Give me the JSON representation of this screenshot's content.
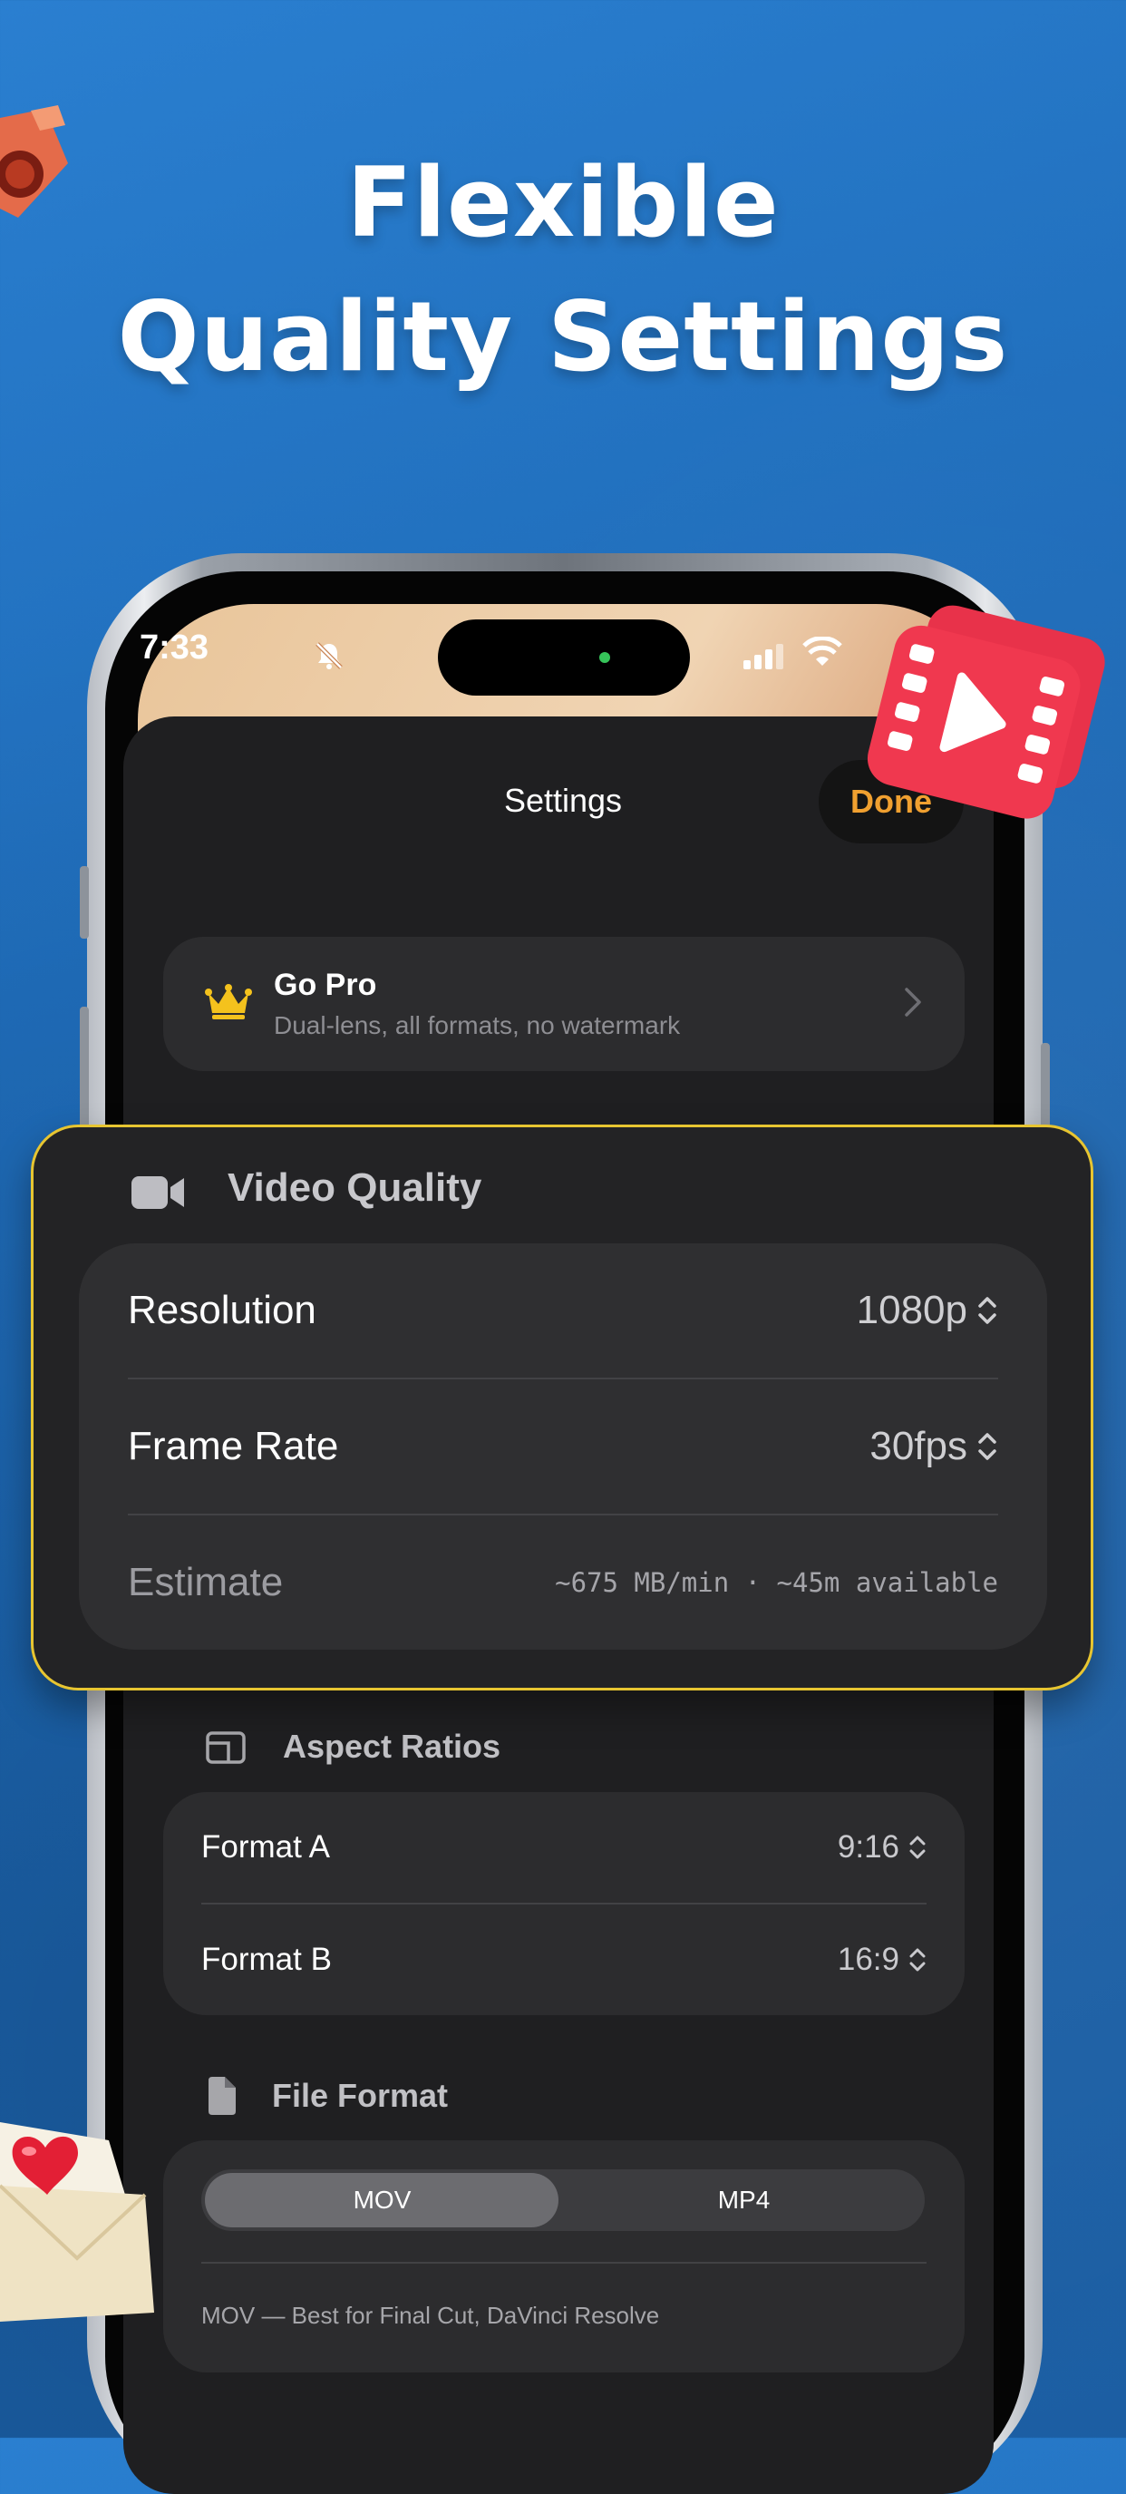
{
  "headline": {
    "line1": "Flexible",
    "line2": "Quality Settings"
  },
  "status_bar": {
    "time": "7:33"
  },
  "sheet": {
    "title": "Settings",
    "done_label": "Done"
  },
  "go_pro": {
    "title": "Go Pro",
    "subtitle": "Dual-lens, all formats, no watermark"
  },
  "video_quality": {
    "header": "Video Quality",
    "resolution": {
      "label": "Resolution",
      "value": "1080p"
    },
    "frame_rate": {
      "label": "Frame Rate",
      "value": "30fps"
    },
    "estimate": {
      "label": "Estimate",
      "value": "~675 MB/min · ~45m available"
    }
  },
  "aspect_ratios": {
    "header": "Aspect Ratios",
    "format_a": {
      "label": "Format A",
      "value": "9:16"
    },
    "format_b": {
      "label": "Format B",
      "value": "16:9"
    }
  },
  "file_format": {
    "header": "File Format",
    "options": [
      "MOV",
      "MP4"
    ],
    "selected": "MOV",
    "note": "MOV — Best for Final Cut, DaVinci Resolve"
  },
  "colors": {
    "accent": "#f0a030",
    "highlight_border": "#e7c531",
    "background": "#1f6cb9"
  },
  "icons": [
    "bell-slash-icon",
    "signal-icon",
    "wifi-icon",
    "crown-icon",
    "chevron-right-icon",
    "video-camera-icon",
    "aspect-ratio-icon",
    "document-icon",
    "up-down-chevron-icon"
  ]
}
